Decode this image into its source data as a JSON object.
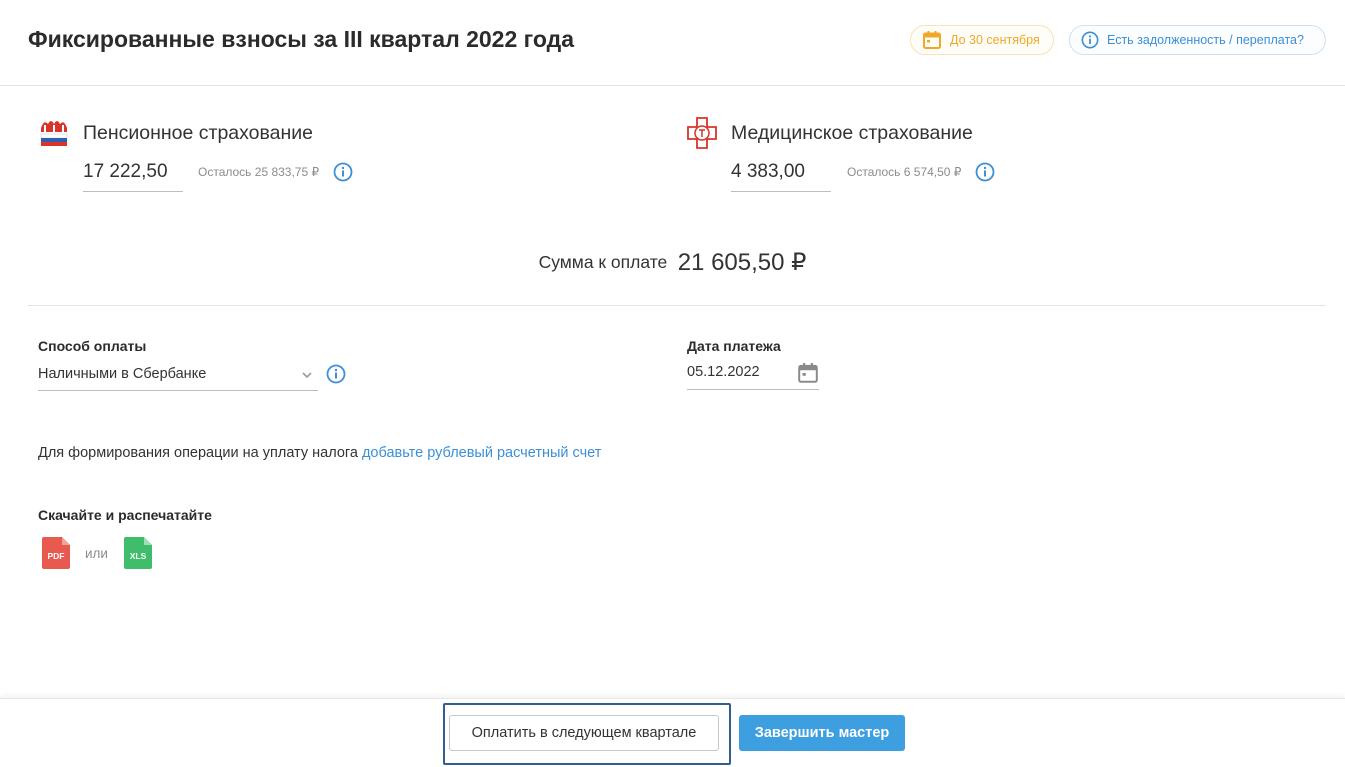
{
  "page": {
    "title": "Фиксированные взносы за III квартал 2022 года",
    "deadline_badge": "До 30 сентября",
    "debt_link": "Есть задолженность / переплата?"
  },
  "pension": {
    "title": "Пенсионное страхование",
    "amount": "17 222,50",
    "remaining": "Осталось 25 833,75 ₽"
  },
  "medical": {
    "title": "Медицинское страхование",
    "amount": "4 383,00",
    "remaining": "Осталось 6 574,50 ₽"
  },
  "total": {
    "label": "Сумма к оплате",
    "value": "21 605,50 ₽"
  },
  "payment": {
    "method_label": "Способ оплаты",
    "method_value": "Наличными в Сбербанке",
    "date_label": "Дата платежа",
    "date_value": "05.12.2022"
  },
  "note": {
    "text": "Для формирования операции на уплату налога ",
    "link": "добавьте рублевый расчетный счет"
  },
  "download": {
    "label": "Скачайте и распечатайте",
    "pdf": "PDF",
    "or": "или",
    "xls": "XLS"
  },
  "footer": {
    "pay_next_quarter": "Оплатить в следующем квартале",
    "finish": "Завершить мастер"
  },
  "colors": {
    "accent_blue": "#3d9fe0",
    "link_blue": "#3b8fd6",
    "deadline_orange": "#f0a826",
    "pdf_red": "#e85a4f",
    "xls_green": "#3fbd6a"
  }
}
